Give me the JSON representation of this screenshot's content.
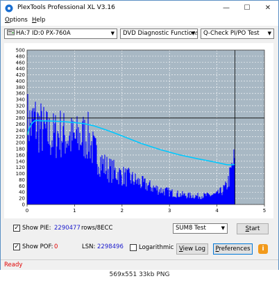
{
  "window": {
    "title": "PlexTools Professional XL V3.16"
  },
  "menu": {
    "options": "ptions",
    "options_mnemonic": "O",
    "help": "elp",
    "help_mnemonic": "H"
  },
  "toolbar": {
    "drive": "HA:7 ID:0  PX-760A",
    "function": "DVD Diagnostic Functions",
    "test": "Q-Check PI/PO Test"
  },
  "controls": {
    "show_pie_label": "Show PIE:",
    "pie_value": "2290477",
    "pie_unit": "rows/8ECC",
    "show_pof_label": "Show POF:",
    "pof_value": "0",
    "lsn_label": "LSN:",
    "lsn_value": "2298496",
    "logarithmic_label": "Logarithmic",
    "sum8_select": "SUM8 Test",
    "start_button": "tart",
    "start_mnemonic": "S",
    "viewlog_button": "iew Log",
    "viewlog_mnemonic": "V",
    "preferences_button": "references",
    "preferences_mnemonic": "P",
    "info": "i"
  },
  "status": {
    "text": "Ready"
  },
  "caption": "569x551  33kb  PNG",
  "colors": {
    "pie": "#0000ff",
    "speed": "#00c8ff",
    "status": "#e00000"
  },
  "chart_data": {
    "type": "area",
    "xlim": [
      0,
      5
    ],
    "ylim": [
      0,
      500
    ],
    "x_ticks": [
      0,
      1,
      2,
      3,
      4,
      5
    ],
    "y_ticks": [
      0,
      20,
      40,
      60,
      80,
      100,
      120,
      140,
      160,
      180,
      200,
      220,
      240,
      260,
      280,
      300,
      320,
      340,
      360,
      380,
      400,
      420,
      440,
      460,
      480,
      500
    ],
    "grid": true,
    "cursor": {
      "x": 4.38,
      "y": 280
    },
    "series": [
      {
        "kind": "area",
        "x": [
          0,
          0.05,
          0.1,
          0.15,
          0.2,
          0.3,
          0.4,
          0.5,
          0.6,
          0.7,
          0.8,
          0.9,
          1.0,
          1.1,
          1.2,
          1.3,
          1.4,
          1.5,
          1.6,
          1.7,
          1.8,
          1.9,
          2.0,
          2.2,
          2.4,
          2.6,
          2.8,
          3.0,
          3.2,
          3.4,
          3.6,
          3.8,
          4.0,
          4.1,
          4.2,
          4.25,
          4.3,
          4.35,
          4.38
        ],
        "y": [
          380,
          360,
          350,
          380,
          360,
          340,
          320,
          300,
          310,
          320,
          305,
          300,
          290,
          300,
          305,
          300,
          240,
          210,
          180,
          160,
          150,
          140,
          130,
          115,
          95,
          80,
          65,
          55,
          45,
          40,
          38,
          40,
          45,
          60,
          80,
          110,
          150,
          190,
          200
        ]
      },
      {
        "kind": "line",
        "x": [
          0,
          0.05,
          0.1,
          0.15,
          0.2,
          0.3,
          0.5,
          0.8,
          1.0,
          1.2,
          1.4,
          1.6,
          1.8,
          2.0,
          2.4,
          2.8,
          3.2,
          3.6,
          4.0,
          4.2,
          4.3,
          4.38
        ],
        "y": [
          225,
          248,
          262,
          270,
          272,
          271,
          270,
          268,
          265,
          262,
          255,
          245,
          234,
          222,
          198,
          178,
          161,
          148,
          136,
          129,
          128,
          130
        ]
      }
    ]
  }
}
